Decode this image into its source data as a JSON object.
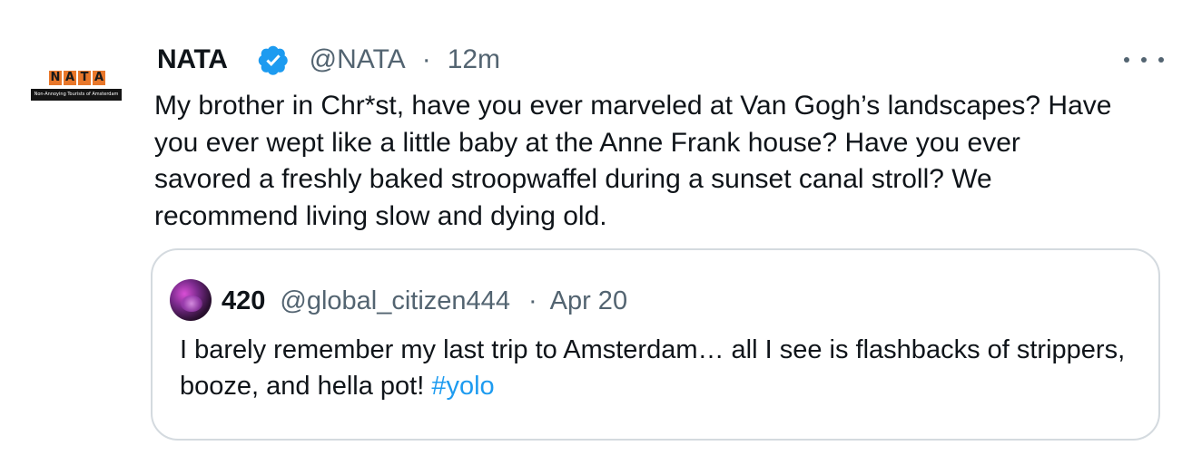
{
  "tweet": {
    "avatar": {
      "logo_letters": [
        "N",
        "A",
        "T",
        "A"
      ],
      "logo_tagline": "Non-Annoying Tourists of Amsterdam"
    },
    "display_name": "NATA",
    "verified_icon": "verified-badge-icon",
    "handle": "@NATA",
    "separator": "·",
    "time": "12m",
    "more_icon": "more-horizontal-icon",
    "text": "My brother in Chr*st, have you ever marveled at Van Gogh’s landscapes? Have you ever wept like a little baby at the Anne Frank house? Have you ever savored a freshly baked stroopwaffel during a sunset canal stroll? We recommend living slow and dying old."
  },
  "quote": {
    "display_name": "420",
    "handle": "@global_citizen444",
    "separator": "·",
    "time": "Apr 20",
    "text": "I barely remember my last trip to Amsterdam… all I see is flashbacks of strippers, booze, and hella pot! ",
    "hashtag": "#yolo"
  },
  "colors": {
    "verified_blue": "#1d9bf0",
    "hashtag_blue": "#1d9bf0",
    "secondary_text": "#536471",
    "logo_orange": "#e8772a",
    "card_border": "#d4dadf"
  }
}
